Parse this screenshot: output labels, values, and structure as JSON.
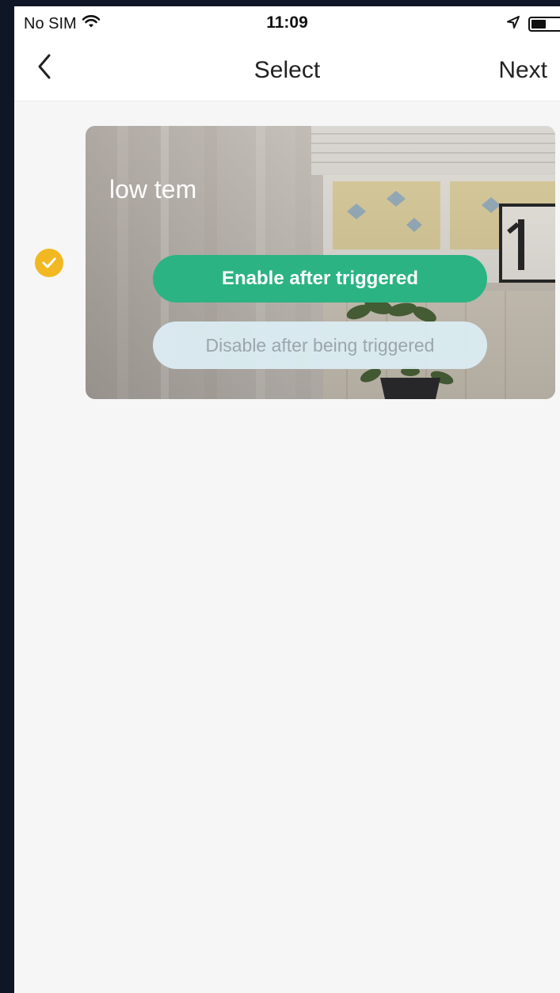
{
  "status_bar": {
    "carrier": "No SIM",
    "time": "11:09",
    "icons": [
      "wifi-icon",
      "location-arrow-icon",
      "battery-icon"
    ]
  },
  "nav": {
    "back_icon": "chevron-left-icon",
    "title": "Select",
    "next_label": "Next"
  },
  "scenes": [
    {
      "name": "low tem",
      "selected": true,
      "options": [
        {
          "label": "Enable after triggered",
          "active": true
        },
        {
          "label": "Disable after being triggered",
          "active": false
        }
      ]
    }
  ],
  "colors": {
    "accent_green": "#2bb384",
    "selected_yellow": "#f2b822",
    "page_background": "#f6f6f6",
    "outer_frame": "#0f1626"
  }
}
